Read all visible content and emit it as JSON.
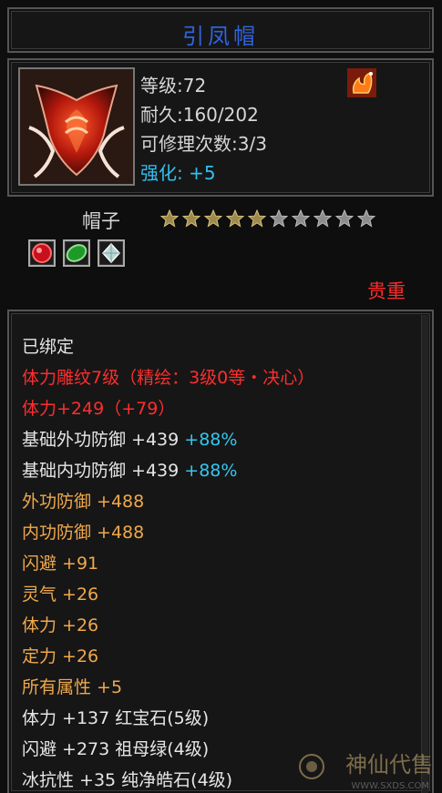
{
  "item": {
    "name": "引凤帽",
    "level": "等级:72",
    "durability": "耐久:160/202",
    "repair_count": "可修理次数:3/3",
    "enhance_label": "强化:",
    "enhance_value": "+5",
    "category": "帽子",
    "rarity": "贵重",
    "stars_total": 10,
    "stars_filled": 5
  },
  "colors": {
    "title": "#2f63e0",
    "rarity": "#ff2a2a",
    "attribute": "#f0a84c",
    "bonus": "#33c7f0",
    "carving": "#ff2d2d"
  },
  "attributes": {
    "bound": "已绑定",
    "carving": "体力雕纹7级（精绘：3级0等・决心）",
    "stamina_main": "体力+249",
    "stamina_bonus": "（+79）",
    "base_outer_def": "基础外功防御 +439",
    "base_outer_pct": "+88%",
    "base_inner_def": "基础内功防御 +439",
    "base_inner_pct": "+88%",
    "outer_def": "外功防御 +488",
    "inner_def": "内功防御 +488",
    "dodge": "闪避 +91",
    "spirit": "灵气 +26",
    "stamina": "体力 +26",
    "focus": "定力 +26",
    "all_attr": "所有属性 +5",
    "gem1": "体力 +137 红宝石(5级)",
    "gem2": "闪避 +273 祖母绿(4级)",
    "gem3": "冰抗性 +35 纯净皓石(4级)"
  },
  "gems": [
    "ruby-icon",
    "emerald-icon",
    "diamond-icon"
  ],
  "watermark": {
    "text": "神仙代售",
    "url": "WWW.SXDS.COM"
  }
}
